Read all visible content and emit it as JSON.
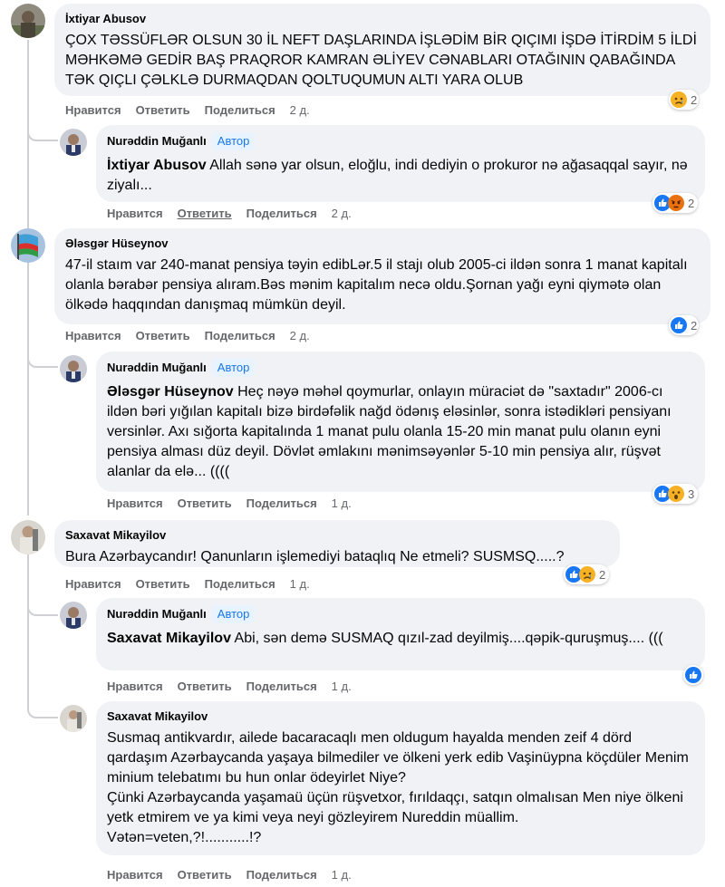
{
  "actions": {
    "like": "Нравится",
    "reply": "Ответить",
    "share": "Поделиться"
  },
  "comments": [
    {
      "author": "İxtiyar Abusov",
      "text": "ÇOX TƏSSÜFLƏR OLSUN 30 İL NEFT DAŞLARINDA İŞLƏDİM BİR QIÇIMI İŞDƏ İTİRDİM 5 İLDİ MƏHKƏMƏ GEDİR BAŞ PRAQROR KAMRAN ƏLİYEV CƏNABLARI OTAĞININ QABAĞINDA TƏK QIÇLI ÇƏLKLƏ DURMAQDAN QOLTUQUMUN ALTI YARA OLUB",
      "time": "2 д.",
      "reaction_count": "2"
    },
    {
      "author": "Nurəddin Muğanlı",
      "badge": "Автор",
      "mention": "İxtiyar Abusov",
      "text": " Allah sənə yar olsun, eloğlu, indi dediyin o prokuror nə ağasaqqal sayır, nə ziyalı...",
      "time": "2 д.",
      "reaction_count": "2"
    },
    {
      "author": "Ələsgər Hüseynov",
      "text": "47-il staım var 240-manat pensiya təyin edibLər.5 il stajı olub 2005-ci ildən sonra 1 manat kapitalı olanla bərabər pensiya alıram.Bəs mənim kapitalım necə oldu.Şornan yağı eyni qiymətə olan ölkədə haqqından danışmaq mümkün deyil.",
      "time": "2 д.",
      "reaction_count": "2"
    },
    {
      "author": "Nurəddin Muğanlı",
      "badge": "Автор",
      "mention": "Ələsgər Hüseynov",
      "text": " Heç nəyə məhəl qoymurlar, onlayın müraciət də \"saxtadır\" 2006-cı ildən bəri yığılan kapitalı bizə birdəfəlik nağd ödənış eləsinlər, sonra istədikləri pensiyanı versinlər. Axı sığorta kapitalında 1 manat pulu olanla 15-20 min manat pulu olanın eyni pensiya alması düz deyil. Dövlət əmlakını mənimsəyənlər 5-10 min pensiya alır, rüşvət alanlar da elə... ((((",
      "time": "1 д.",
      "reaction_count": "3"
    },
    {
      "author": "Saxavat Mikayilov",
      "text": "Bura Azərbaycandır! Qanunların işlemediyi bataqlıq Ne etmeli? SUSMSQ.....?",
      "time": "1 д.",
      "reaction_count": "2"
    },
    {
      "author": "Nurəddin Muğanlı",
      "badge": "Автор",
      "mention": "Saxavat Mikayilov",
      "text": " Abi, sən demə SUSMAQ qızıl-zad deyilmiş....qəpik-quruşmuş.... (((",
      "time": "1 д."
    },
    {
      "author": "Saxavat Mikayilov",
      "text": "Susmaq antikvardır, ailede bacaracaqlı men oldugum hayalda menden zeif 4 dörd qardaşım Azərbaycanda yaşaya bilmediler ve ölkeni yerk edib Vaşinüypna köçdüler Menim minium telebatımı bu hun onlar ödeyirlet Niye?\nÇünki Azərbaycanda yaşamaü üçün rüşvetxor, fırıldaqçı, satqın olmalısan Men niye ölkeni yetk etmirem ve ya kimi veya neyi gözleyirem Nureddin müallim.\nVətən=veten,?!...........!?",
      "time": "1 д."
    }
  ],
  "colors": {
    "like_blue": "#1877f2",
    "reaction_yellow": "#f7b125",
    "angry_red": "#e9710f",
    "meta_text": "#65676b"
  }
}
